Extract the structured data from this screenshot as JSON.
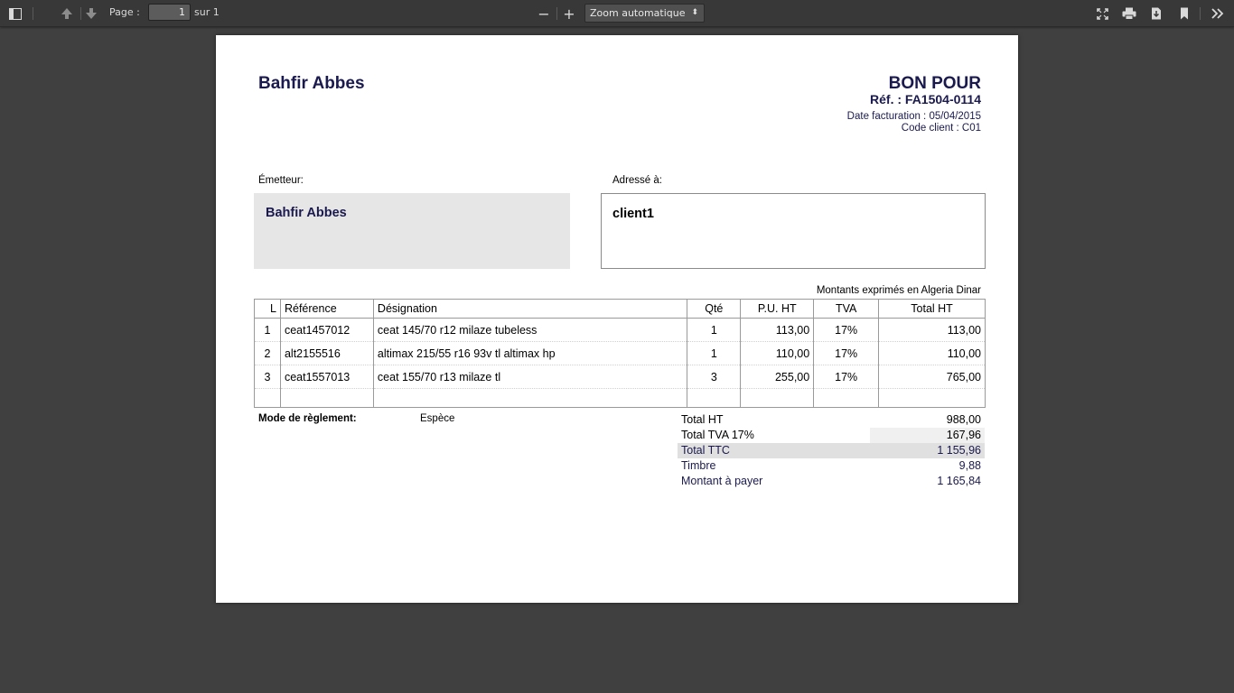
{
  "toolbar": {
    "page_label": "Page :",
    "page_value": "1",
    "page_count": "sur 1",
    "zoom_minus": "−",
    "zoom_plus": "+",
    "zoom_value": "Zoom automatique"
  },
  "document": {
    "company": "Bahfir Abbes",
    "title": "BON POUR",
    "ref": "Réf. : FA1504-0114",
    "date": "Date facturation : 05/04/2015",
    "client_code": "Code client : C01",
    "emitter_label": "Émetteur:",
    "emitter_name": "Bahfir Abbes",
    "recipient_label": "Adressé à:",
    "recipient_name": "client1",
    "currency_note": "Montants exprimés en Algeria Dinar",
    "columns": [
      "L",
      "Référence",
      "Désignation",
      "Qté",
      "P.U. HT",
      "TVA",
      "Total HT"
    ],
    "lines": [
      {
        "l": "1",
        "ref": "ceat1457012",
        "designation": "ceat 145/70 r12 milaze tubeless",
        "qty": "1",
        "pu": "113,00",
        "tva": "17%",
        "total": "113,00"
      },
      {
        "l": "2",
        "ref": "alt2155516",
        "designation": "altimax 215/55 r16 93v tl altimax hp",
        "qty": "1",
        "pu": "110,00",
        "tva": "17%",
        "total": "110,00"
      },
      {
        "l": "3",
        "ref": "ceat1557013",
        "designation": "ceat 155/70 r13 milaze tl",
        "qty": "3",
        "pu": "255,00",
        "tva": "17%",
        "total": "765,00"
      }
    ],
    "payment_label": "Mode de règlement:",
    "payment_value": "Espèce",
    "totals": [
      {
        "label": "Total HT",
        "value": "988,00"
      },
      {
        "label": "Total TVA 17%",
        "value": "167,96"
      },
      {
        "label": "Total TTC",
        "value": "1 155,96"
      },
      {
        "label": "Timbre",
        "value": "9,88"
      },
      {
        "label": "Montant à payer",
        "value": "1 165,84"
      }
    ]
  }
}
